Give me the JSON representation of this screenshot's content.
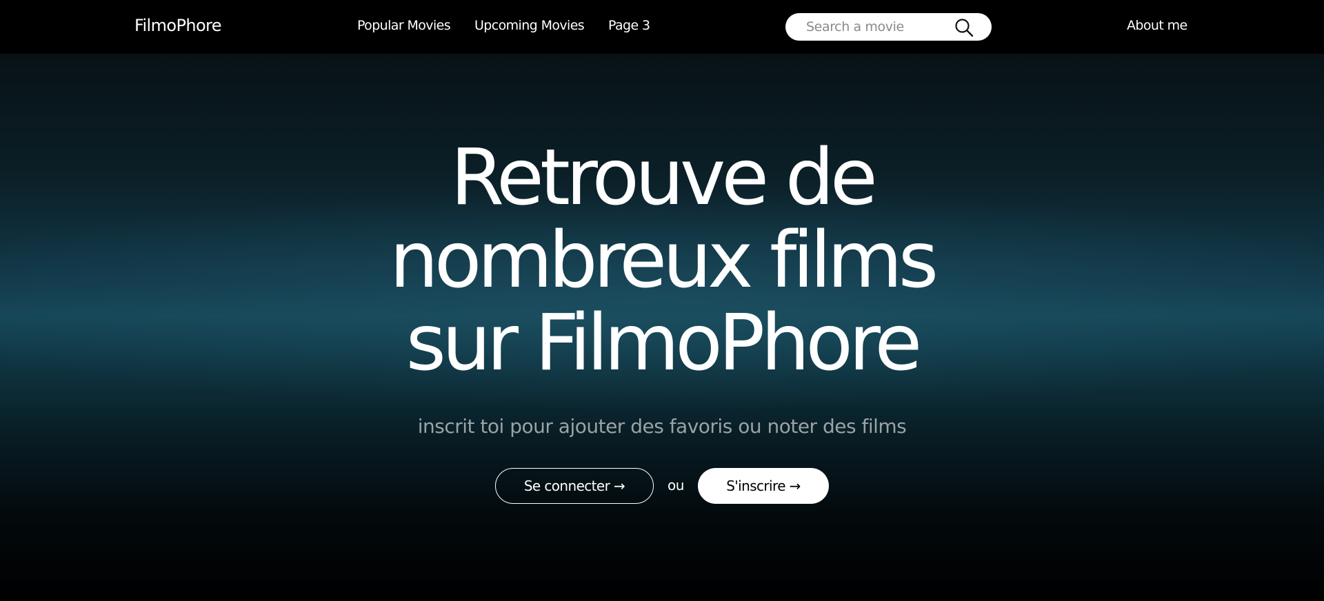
{
  "navbar": {
    "brand": "FilmoPhore",
    "links": [
      {
        "label": "Popular Movies"
      },
      {
        "label": "Upcoming Movies"
      },
      {
        "label": "Page 3"
      }
    ],
    "search": {
      "placeholder": "Search a movie",
      "value": "",
      "icon": "search-icon"
    },
    "about_label": "About me"
  },
  "hero": {
    "title_lines": [
      "Retrouve de",
      "nombreux films",
      "sur FilmoPhore"
    ],
    "subtitle": "inscrit toi pour ajouter des favoris ou noter des films",
    "login_button": "Se connecter →",
    "or_text": "ou",
    "signup_button": "S'inscrire →"
  },
  "colors": {
    "navbar_background": "#000000",
    "hero_glow": "#154657",
    "subtitle_text": "#9aa3a6",
    "primary_button_background": "#ffffff",
    "primary_button_text": "#000000"
  }
}
